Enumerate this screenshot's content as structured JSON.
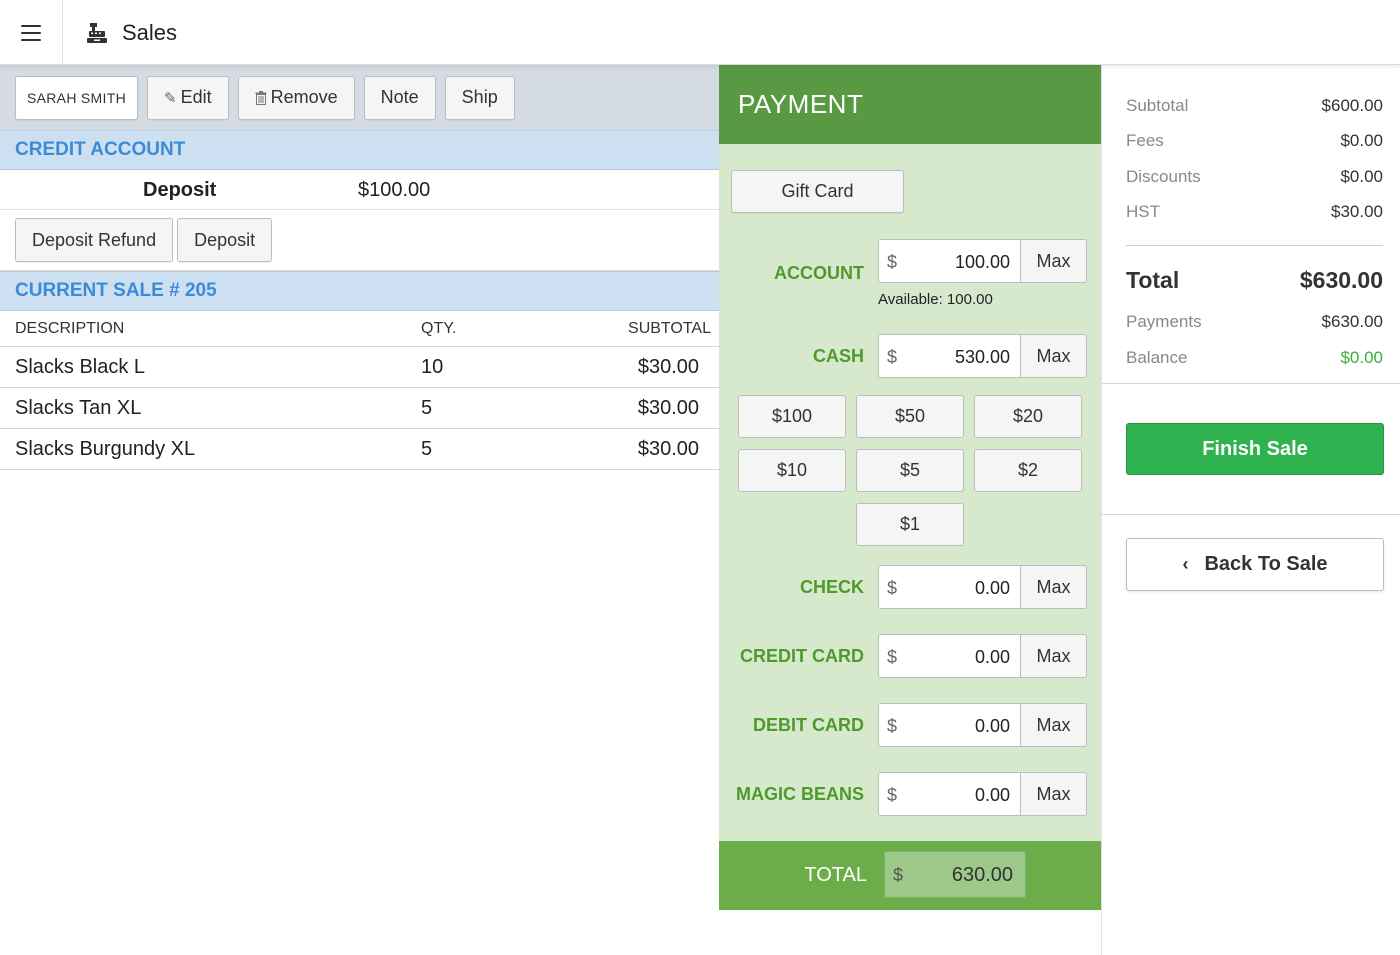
{
  "app": {
    "title": "Sales"
  },
  "customer": {
    "name": "SARAH SMITH",
    "edit_label": "Edit",
    "remove_label": "Remove",
    "note_label": "Note",
    "ship_label": "Ship"
  },
  "credit_account": {
    "heading": "CREDIT ACCOUNT",
    "deposit_label": "Deposit",
    "deposit_value": "$100.00",
    "refund_button": "Deposit Refund",
    "deposit_button": "Deposit"
  },
  "current_sale": {
    "heading": "CURRENT SALE # 205",
    "columns": {
      "description": "DESCRIPTION",
      "qty": "QTY.",
      "subtotal": "SUBTOTAL"
    },
    "items": [
      {
        "description": "Slacks Black L",
        "qty": "10",
        "subtotal": "$30.00"
      },
      {
        "description": "Slacks Tan XL",
        "qty": "5",
        "subtotal": "$30.00"
      },
      {
        "description": "Slacks Burgundy XL",
        "qty": "5",
        "subtotal": "$30.00"
      }
    ]
  },
  "payment": {
    "heading": "PAYMENT",
    "gift_card_label": "Gift Card",
    "currency_symbol": "$",
    "max_label": "Max",
    "available_text": "Available: 100.00",
    "methods": [
      {
        "label": "ACCOUNT",
        "amount": "100.00"
      },
      {
        "label": "CASH",
        "amount": "530.00"
      },
      {
        "label": "CHECK",
        "amount": "0.00"
      },
      {
        "label": "CREDIT CARD",
        "amount": "0.00"
      },
      {
        "label": "DEBIT CARD",
        "amount": "0.00"
      },
      {
        "label": "MAGIC BEANS",
        "amount": "0.00"
      }
    ],
    "cash_buttons": [
      "$100",
      "$50",
      "$20",
      "$10",
      "$5",
      "$2",
      "$1"
    ],
    "total_label": "TOTAL",
    "total_amount": "630.00"
  },
  "summary": {
    "subtotal_label": "Subtotal",
    "subtotal": "$600.00",
    "fees_label": "Fees",
    "fees": "$0.00",
    "discounts_label": "Discounts",
    "discounts": "$0.00",
    "hst_label": "HST",
    "hst": "$30.00",
    "total_label": "Total",
    "total": "$630.00",
    "payments_label": "Payments",
    "payments": "$630.00",
    "balance_label": "Balance",
    "balance": "$0.00",
    "finish_label": "Finish Sale",
    "back_label": "Back To Sale"
  },
  "colors": {
    "payment_header": "#5a9944",
    "payment_bg": "#d6e9cd",
    "section_head": "#cde0f2",
    "section_text": "#3b8bd6",
    "finish_button": "#2eb350",
    "balance_text": "#3ab03a"
  },
  "icons": {
    "menu": "hamburger-icon",
    "app": "cash-register-icon",
    "edit": "pencil-icon",
    "remove": "trash-icon",
    "back": "chevron-left-icon"
  }
}
